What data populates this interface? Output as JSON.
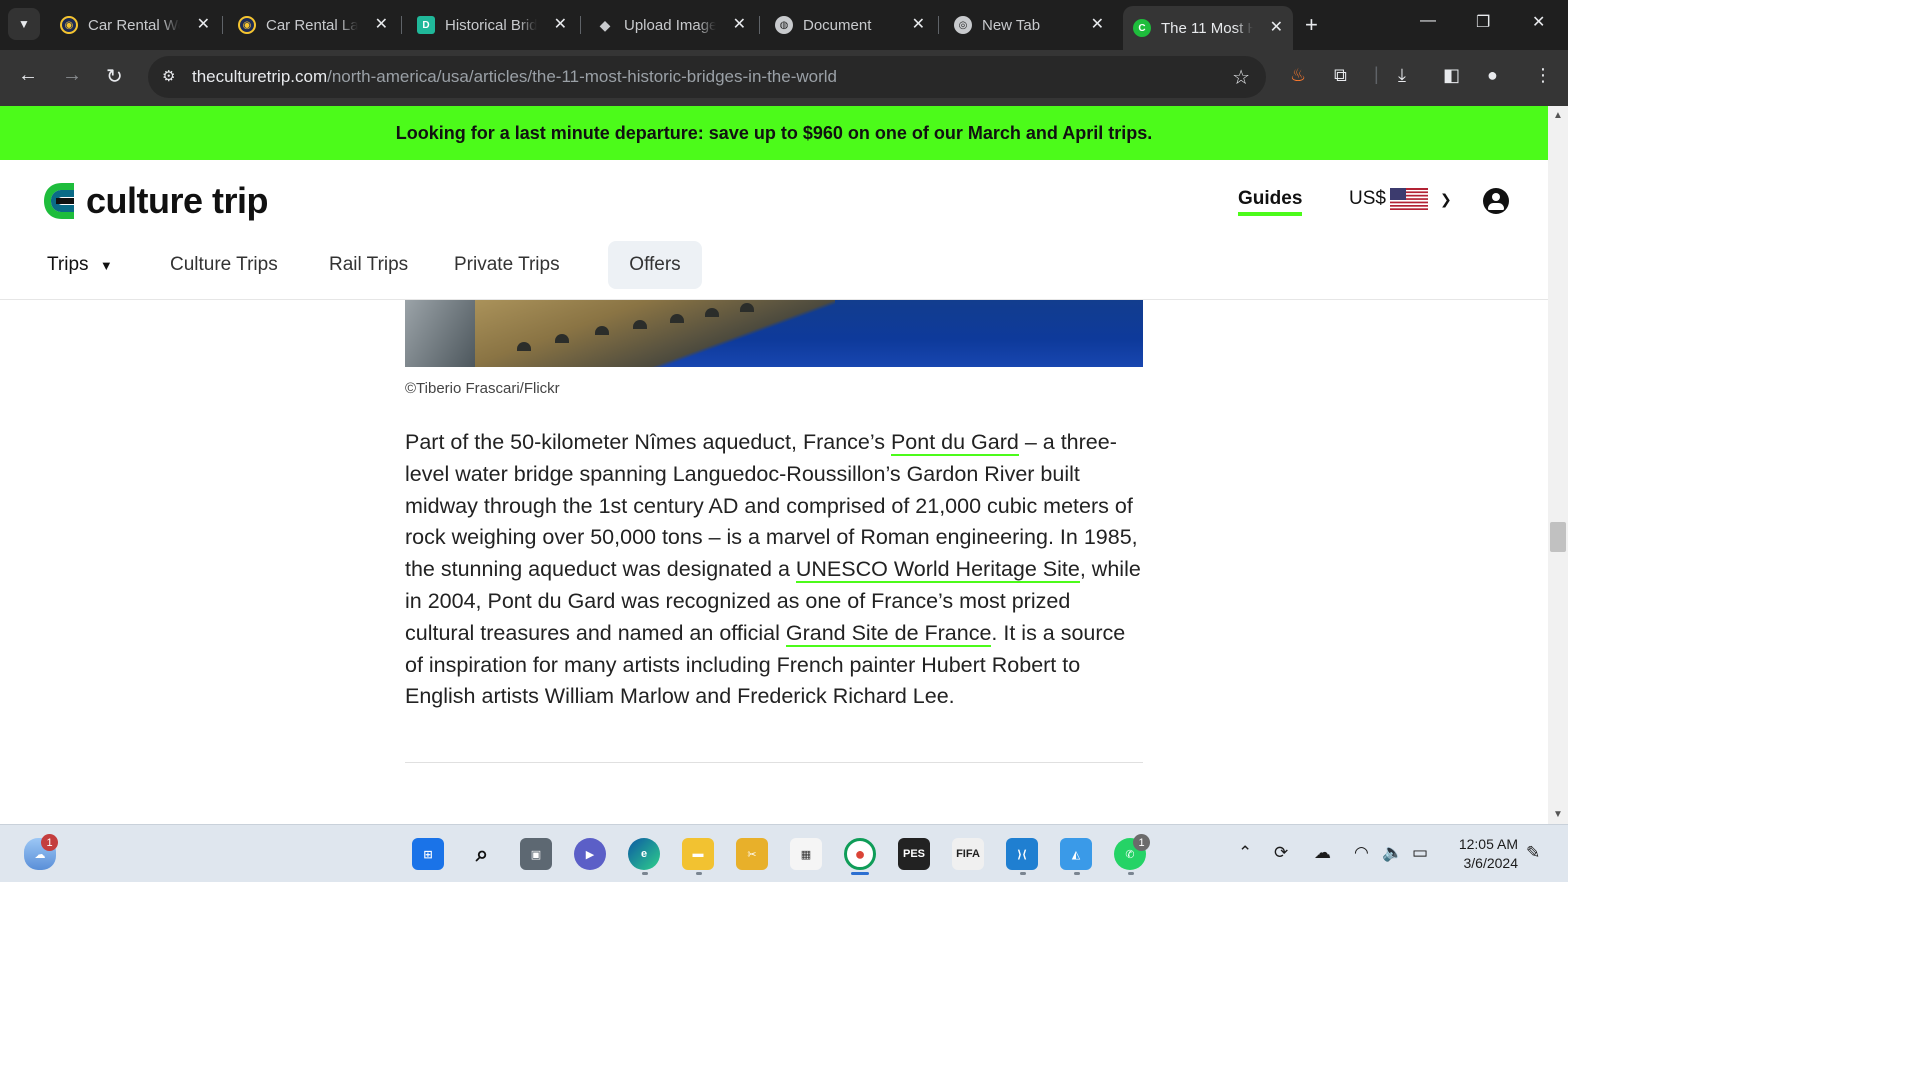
{
  "browser": {
    "tabs": [
      {
        "label": "Car Rental We",
        "icon": "car-rental-favicon",
        "active": false
      },
      {
        "label": "Car Rental Lar",
        "icon": "car-rental-favicon",
        "active": false
      },
      {
        "label": "Historical Brid",
        "icon": "document-favicon",
        "active": false
      },
      {
        "label": "Upload Image",
        "icon": "upload-favicon",
        "active": false
      },
      {
        "label": "Document",
        "icon": "globe-favicon",
        "active": false
      },
      {
        "label": "New Tab",
        "icon": "chrome-favicon",
        "active": false
      },
      {
        "label": "The 11 Most H",
        "icon": "culture-trip-favicon",
        "active": true
      }
    ],
    "url_host": "theculturetrip.com",
    "url_path": "/north-america/usa/articles/the-11-most-historic-bridges-in-the-world"
  },
  "promo": {
    "text": "Looking for a last minute departure: save up to $960 on one of our March and April trips.",
    "color": "#4cfb1a"
  },
  "header": {
    "logo_text": "culture trip",
    "guides": "Guides",
    "currency": "US$",
    "nav": {
      "trips": "Trips",
      "culture_trips": "Culture Trips",
      "rail_trips": "Rail Trips",
      "private_trips": "Private Trips",
      "offers": "Offers"
    }
  },
  "article": {
    "caption": "©Tiberio Frascari/Flickr",
    "p1": "Part of the 50-kilometer Nîmes aqueduct, France’s ",
    "link1": "Pont du Gard",
    "p2": " – a three-level water bridge spanning Languedoc-Roussillon’s Gardon River built midway through the 1st century AD and comprised of 21,000 cubic meters of rock weighing over 50,000 tons – is a marvel of Roman engineering. In 1985, the stunning aqueduct was designated a ",
    "link2": "UNESCO World Heritage Site",
    "p3": ", while in 2004, Pont du Gard was recognized as one of France’s most prized cultural treasures and named an official ",
    "link3": "Grand Site de France",
    "p4": ". It is a source of inspiration for many artists including French painter Hubert Robert to English artists William Marlow and Frederick Richard Lee."
  },
  "taskbar": {
    "weather_badge": "1",
    "whatsapp_badge": "1",
    "time": "12:05 AM",
    "date": "3/6/2024"
  }
}
